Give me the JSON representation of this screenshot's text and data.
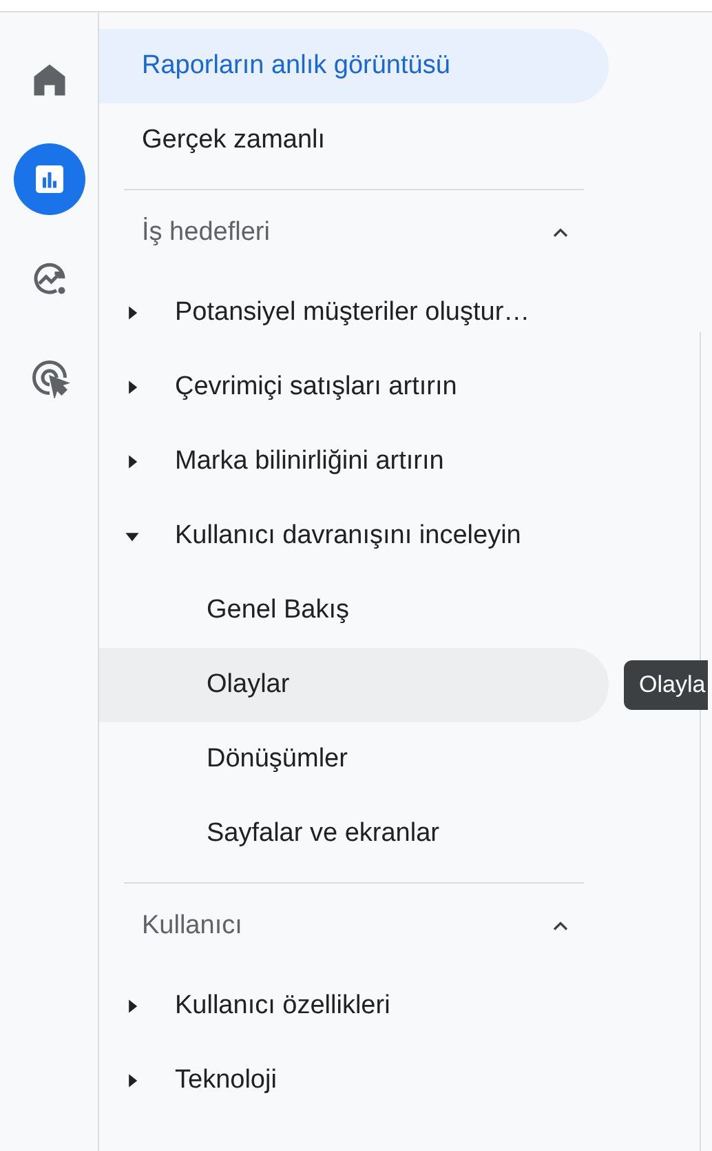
{
  "rail": [
    {
      "kind": "home",
      "selected": false
    },
    {
      "kind": "reports",
      "selected": true
    },
    {
      "kind": "explore",
      "selected": false
    },
    {
      "kind": "advertising",
      "selected": false
    }
  ],
  "top_items": [
    {
      "label": "Raporların anlık görüntüsü",
      "selected": true
    },
    {
      "label": "Gerçek zamanlı",
      "selected": false
    }
  ],
  "sections": [
    {
      "title": "İş hedefleri",
      "expanded": true,
      "items": [
        {
          "label": "Potansiyel müşteriler oluştur…",
          "expanded": false
        },
        {
          "label": "Çevrimiçi satışları artırın",
          "expanded": false
        },
        {
          "label": "Marka bilinirliğini artırın",
          "expanded": false
        },
        {
          "label": "Kullanıcı davranışını inceleyin",
          "expanded": true,
          "children": [
            {
              "label": "Genel Bakış",
              "hovered": false
            },
            {
              "label": "Olaylar",
              "hovered": true
            },
            {
              "label": "Dönüşümler",
              "hovered": false
            },
            {
              "label": "Sayfalar ve ekranlar",
              "hovered": false
            }
          ]
        }
      ]
    },
    {
      "title": "Kullanıcı",
      "expanded": true,
      "items": [
        {
          "label": "Kullanıcı özellikleri",
          "expanded": false
        },
        {
          "label": "Teknoloji",
          "expanded": false
        }
      ]
    }
  ],
  "tooltip": "Olayla"
}
